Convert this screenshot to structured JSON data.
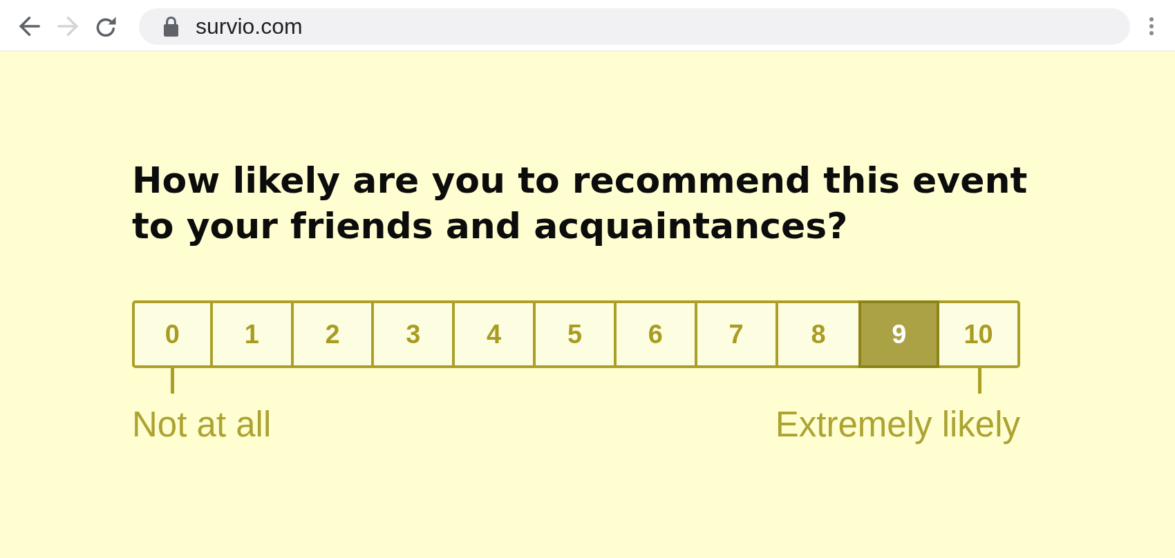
{
  "browser": {
    "nav_buttons": [
      {
        "kind": "back",
        "disabled": false
      },
      {
        "kind": "forward",
        "disabled": true
      },
      {
        "kind": "reload",
        "disabled": false
      }
    ],
    "url": "survio.com"
  },
  "question": "How likely are you to recommend this event to your friends and acquaintances?",
  "scale": {
    "options": [
      {
        "label": "0",
        "selected": false
      },
      {
        "label": "1",
        "selected": false
      },
      {
        "label": "2",
        "selected": false
      },
      {
        "label": "3",
        "selected": false
      },
      {
        "label": "4",
        "selected": false
      },
      {
        "label": "5",
        "selected": false
      },
      {
        "label": "6",
        "selected": false
      },
      {
        "label": "7",
        "selected": false
      },
      {
        "label": "8",
        "selected": false
      },
      {
        "label": "9",
        "selected": true
      },
      {
        "label": "10",
        "selected": false
      }
    ],
    "min_label": "Not at all",
    "max_label": "Extremely likely"
  }
}
